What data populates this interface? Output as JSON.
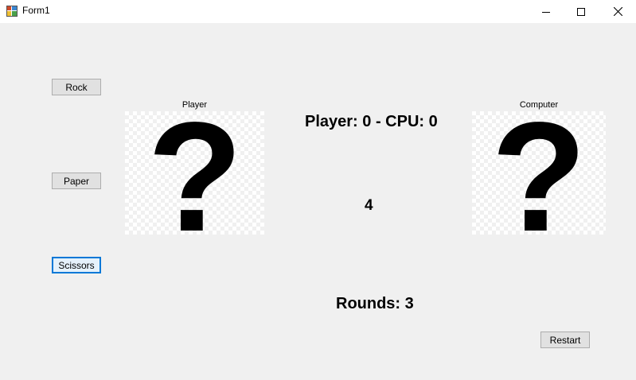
{
  "window": {
    "title": "Form1",
    "icon": "winforms-app-icon"
  },
  "controls": {
    "minimize_icon": "minimize-icon",
    "maximize_icon": "maximize-icon",
    "close_icon": "close-icon"
  },
  "buttons": {
    "rock": "Rock",
    "paper": "Paper",
    "scissors": "Scissors",
    "restart": "Restart"
  },
  "player_panel": {
    "label": "Player",
    "image": "question-mark-icon"
  },
  "computer_panel": {
    "label": "Computer",
    "image": "question-mark-icon"
  },
  "score_text": "Player: 0 - CPU: 0",
  "countdown": "4",
  "rounds_text": "Rounds: 3",
  "colors": {
    "form_background": "#f0f0f0",
    "focus_border": "#0078d7"
  }
}
